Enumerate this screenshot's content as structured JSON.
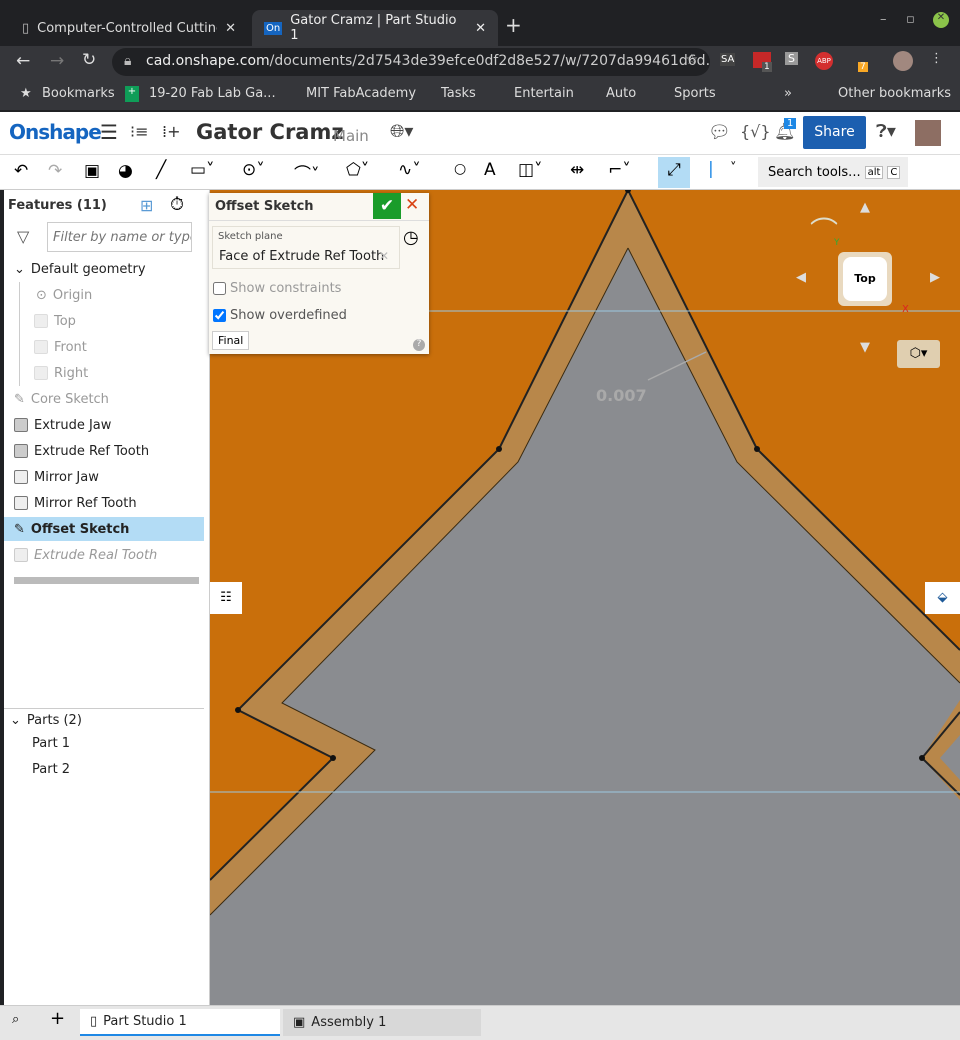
{
  "browser": {
    "tabs": [
      {
        "title": "Computer-Controlled Cutting"
      },
      {
        "title": "Gator Cramz | Part Studio 1",
        "active": true
      }
    ],
    "url_domain": "cad.onshape.com",
    "url_path": "/documents/2d7543de39efce0df2d8e527/w/7207da99461d6d...",
    "extension_badges": [
      "1",
      "7"
    ],
    "extensions": [
      "SA",
      "S",
      "ABP"
    ],
    "bookmarks": [
      "Bookmarks",
      "19-20 Fab Lab Ga...",
      "MIT FabAcademy",
      "Tasks",
      "Entertain",
      "Auto",
      "Sports"
    ],
    "more": "»",
    "other_bookmarks": "Other bookmarks"
  },
  "app": {
    "logo": "Onshape",
    "doc_title": "Gator Cramz",
    "branch": "Main",
    "notif_count": "1",
    "share": "Share"
  },
  "toolbar": {
    "search": "Search tools...",
    "shortcut_keys": [
      "alt",
      "C"
    ]
  },
  "features": {
    "title": "Features (11)",
    "filter_placeholder": "Filter by name or type",
    "group": "Default geometry",
    "default_items": [
      "Origin",
      "Top",
      "Front",
      "Right"
    ],
    "items": [
      {
        "label": "Core Sketch",
        "state": "dim"
      },
      {
        "label": "Extrude Jaw"
      },
      {
        "label": "Extrude Ref Tooth"
      },
      {
        "label": "Mirror Jaw"
      },
      {
        "label": "Mirror Ref Tooth"
      },
      {
        "label": "Offset Sketch",
        "state": "selected"
      },
      {
        "label": "Extrude Real Tooth",
        "state": "rolled-back"
      }
    ],
    "parts_title": "Parts (2)",
    "parts": [
      "Part 1",
      "Part 2"
    ]
  },
  "dialog": {
    "title": "Offset Sketch",
    "plane_label": "Sketch plane",
    "plane_value": "Face of Extrude Ref Tooth",
    "show_constraints": "Show constraints",
    "show_constraints_checked": false,
    "show_overdefined": "Show overdefined",
    "show_overdefined_checked": true,
    "final": "Final"
  },
  "viewport": {
    "dimension": "0.007",
    "view_cube": "Top",
    "axis_x": "X",
    "axis_y": "Y",
    "face_color": "#c96f0b",
    "offset_color": "#b8874a",
    "inner_color": "#8a8c90"
  },
  "bottom": {
    "tabs": [
      "Part Studio 1",
      "Assembly 1"
    ]
  }
}
